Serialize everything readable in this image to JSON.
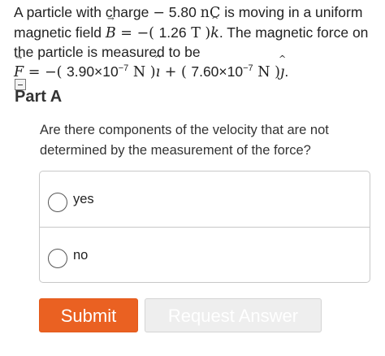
{
  "problem": {
    "t1": "A particle with charge ",
    "charge_minus": "−",
    "charge_value": " 5.80 ",
    "charge_unit": "nC",
    "t2": " is moving in a uniform magnetic field ",
    "b_symbol": "B",
    "b_eq": " = −( ",
    "b_value": "1.26",
    "b_unit": " T )",
    "k_symbol": "k",
    "t3": ". The magnetic force on the particle is measured to be",
    "f_symbol": "F",
    "f_eq": " = −( ",
    "f_x_mantissa": "3.90×10",
    "f_x_exp": "−7",
    "f_x_unit": " N )",
    "i_symbol": "ı",
    "f_plus": " + ( ",
    "f_y_mantissa": "7.60×10",
    "f_y_exp": "−7",
    "f_y_unit": " N )",
    "j_symbol": "ȷ",
    "t_end": "."
  },
  "part": {
    "title": "Part A",
    "question": "Are there components of the velocity that are not determined by the measurement of the force?"
  },
  "options": [
    {
      "label": "yes",
      "selected": false
    },
    {
      "label": "no",
      "selected": false
    }
  ],
  "buttons": {
    "submit": "Submit",
    "request": "Request Answer"
  },
  "colors": {
    "submit_bg": "#ea6122",
    "request_bg": "#eeeeee"
  }
}
